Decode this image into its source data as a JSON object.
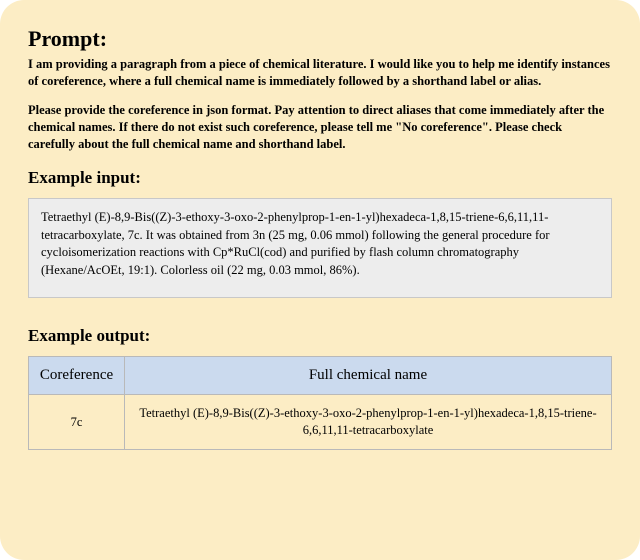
{
  "headings": {
    "prompt": "Prompt:",
    "example_input": "Example input:",
    "example_output": "Example output:"
  },
  "prompt": {
    "para1": "I am providing a paragraph from a piece of chemical literature. I would like you to help me identify instances of coreference, where a full chemical name is immediately followed by a shorthand label or alias.",
    "para2": "Please provide the coreference in json format. Pay attention to direct aliases that come immediately after the chemical names. If there do not exist such coreference, please tell me \"No coreference\". Please check carefully about the full chemical name and shorthand label."
  },
  "example_input": "Tetraethyl (E)-8,9-Bis((Z)-3-ethoxy-3-oxo-2-phenylprop-1-en-1-yl)hexadeca-1,8,15-triene-6,6,11,11-tetracarboxylate, 7c. It was obtained from 3n (25 mg, 0.06 mmol) following the general procedure for cycloisomerization reactions with Cp*RuCl(cod) and purified by flash column chromatography (Hexane/AcOEt, 19:1). Colorless oil (22 mg, 0.03 mmol, 86%).",
  "output_table": {
    "headers": {
      "coreference": "Coreference",
      "full_name": "Full chemical name"
    },
    "row": {
      "coreference": "7c",
      "full_name": "Tetraethyl (E)-8,9-Bis((Z)-3-ethoxy-3-oxo-2-phenylprop-1-en-1-yl)hexadeca-1,8,15-triene-6,6,11,11-tetracarboxylate"
    }
  }
}
